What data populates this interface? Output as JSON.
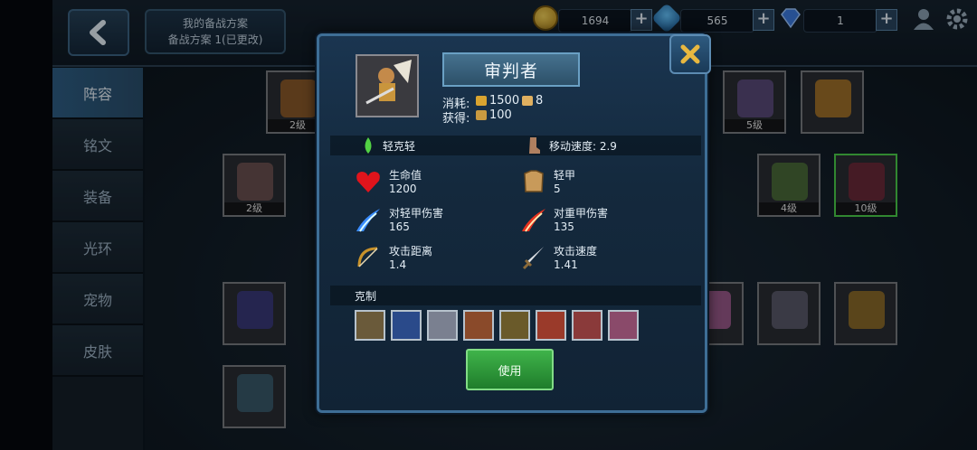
{
  "topbar": {
    "plan_title": "我的备战方案",
    "plan_subtitle": "备战方案 1(已更改)",
    "gold": "1694",
    "crystal": "565",
    "diamond": "1"
  },
  "sidebar": {
    "items": [
      {
        "label": "阵容",
        "active": true
      },
      {
        "label": "铭文",
        "active": false
      },
      {
        "label": "装备",
        "active": false
      },
      {
        "label": "光环",
        "active": false
      },
      {
        "label": "宠物",
        "active": false
      },
      {
        "label": "皮肤",
        "active": false
      }
    ]
  },
  "cards": {
    "levels": [
      "2级",
      "5级",
      "2级",
      "4级",
      "10级"
    ]
  },
  "modal": {
    "unit_name": "审判者",
    "cost_label": "消耗:",
    "cost_gold": "1500",
    "cost_pop": "8",
    "gain_label": "获得:",
    "gain_value": "100",
    "armor_counter": "轻克轻",
    "move_speed": "移动速度: 2.9",
    "stats": [
      {
        "label": "生命值",
        "value": "1200",
        "icon": "heart-icon"
      },
      {
        "label": "轻甲",
        "value": "5",
        "icon": "light-armor-icon"
      },
      {
        "label": "对轻甲伤害",
        "value": "165",
        "icon": "blue-slash-icon"
      },
      {
        "label": "对重甲伤害",
        "value": "135",
        "icon": "red-slash-icon"
      },
      {
        "label": "攻击距离",
        "value": "1.4",
        "icon": "bow-icon"
      },
      {
        "label": "攻击速度",
        "value": "1.41",
        "icon": "sword-icon"
      }
    ],
    "counters_label": "克制",
    "use_button": "使用"
  },
  "colors": {
    "accent_blue": "#3e6e96",
    "use_green": "#2f9a3b",
    "close_x": "#e8b840"
  }
}
